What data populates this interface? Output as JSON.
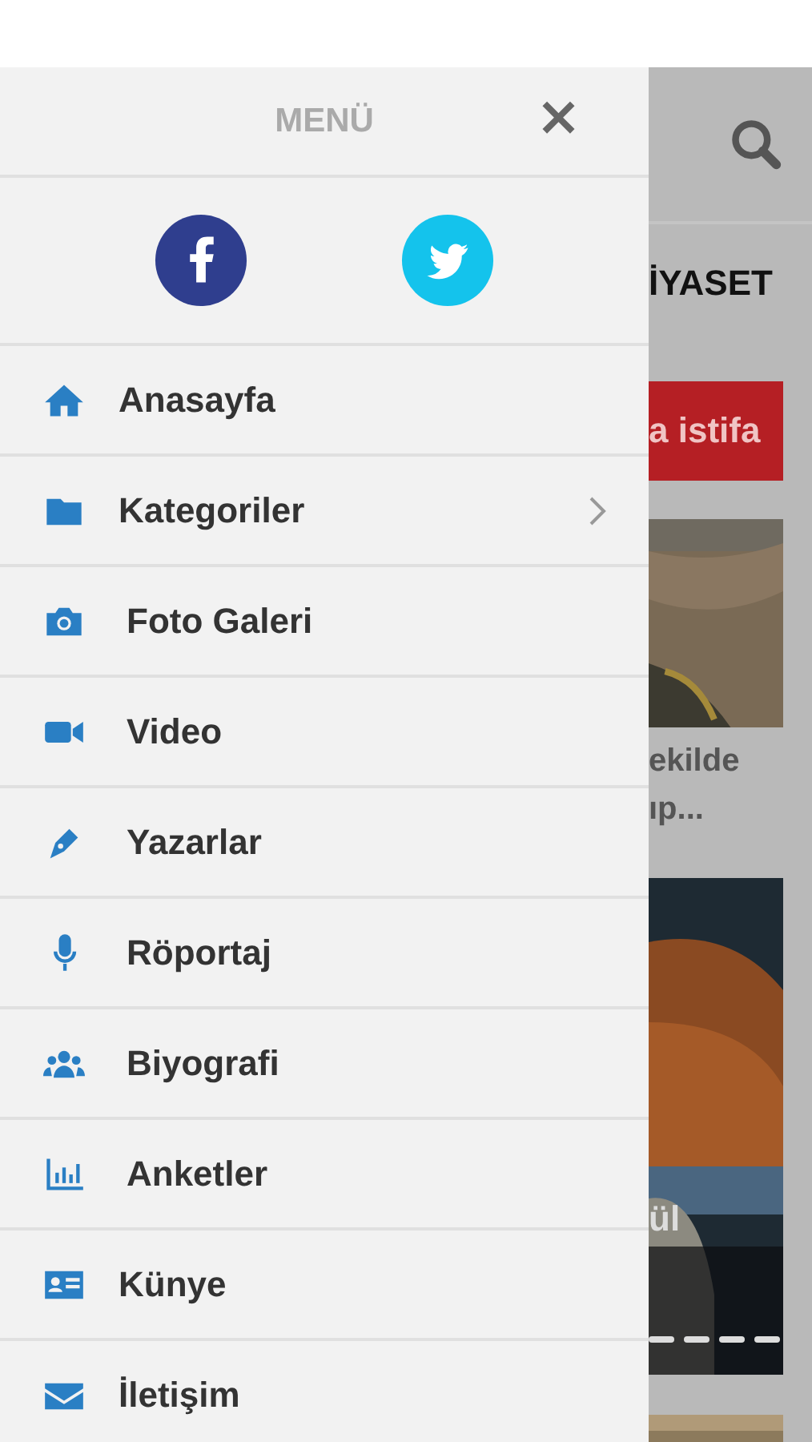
{
  "menu": {
    "title": "MENÜ",
    "close": "×"
  },
  "items": [
    {
      "label": "Anasayfa",
      "has_submenu": false
    },
    {
      "label": "Kategoriler",
      "has_submenu": true
    },
    {
      "label": "Foto Galeri",
      "has_submenu": false
    },
    {
      "label": "Video",
      "has_submenu": false
    },
    {
      "label": "Yazarlar",
      "has_submenu": false
    },
    {
      "label": "Röportaj",
      "has_submenu": false
    },
    {
      "label": "Biyografi",
      "has_submenu": false
    },
    {
      "label": "Anketler",
      "has_submenu": false
    },
    {
      "label": "Künye",
      "has_submenu": false
    },
    {
      "label": "İletişim",
      "has_submenu": false
    }
  ],
  "background_page": {
    "nav_tab": "İYASET",
    "banner": "a istifa",
    "headline_lines": [
      "ekilde",
      "ıp..."
    ],
    "slide_caption": "ül"
  }
}
